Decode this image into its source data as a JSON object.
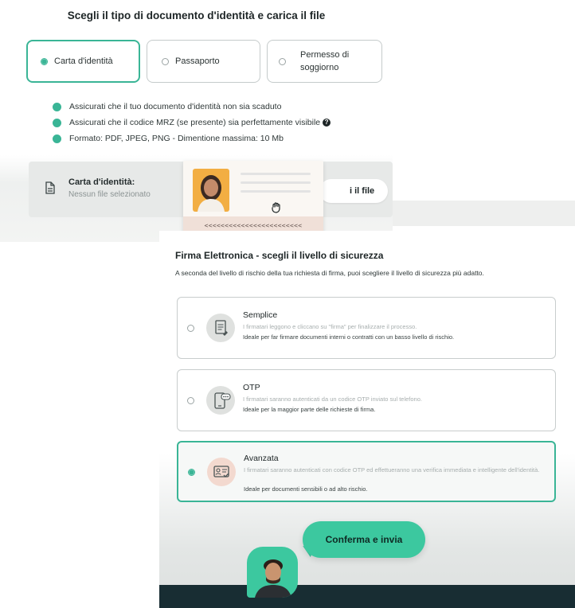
{
  "colors": {
    "accent": "#3ab596",
    "button": "#3cc89f",
    "footer": "#182d33"
  },
  "upload": {
    "title": "Scegli il tipo di documento d'identità e carica il file",
    "doc_types": [
      {
        "label": "Carta d'identità",
        "selected": true
      },
      {
        "label": "Passaporto",
        "selected": false
      },
      {
        "label_line1": "Permesso di",
        "label_line2": "soggiorno",
        "selected": false
      }
    ],
    "checks": [
      "Assicurati che il tuo documento d'identità non sia scaduto",
      "Assicurati che il codice MRZ (se presente) sia perfettamente visibile",
      "Formato: PDF, JPEG, PNG - Dimentione massima: 10 Mb"
    ],
    "info_icon": "?",
    "file": {
      "title": "Carta d'identità:",
      "status": "Nessun file selezionato",
      "button_fragment": "i il file"
    },
    "id_card": {
      "mrz": "<<<<<<<<<<<<<<<<<<<<<<<<"
    },
    "icons": [
      "file-icon",
      "hand-tap-icon",
      "info-icon"
    ]
  },
  "signature": {
    "title": "Firma Elettronica - scegli il livello di sicurezza",
    "subtitle": "A seconda del livello di rischio della tua richiesta di firma, puoi scegliere il livello di sicurezza più adatto.",
    "options": [
      {
        "name": "Semplice",
        "desc": "I firmatari leggono e cliccano su \"firma\" per finalizzare il processo.",
        "note": "Ideale per far firmare documenti interni o contratti con un basso livello di rischio.",
        "selected": false,
        "icon": "document-sign-icon"
      },
      {
        "name": "OTP",
        "desc": "I firmatari saranno autenticati da un codice OTP inviato sul telefono.",
        "note": "Ideale per la maggior parte delle richieste di firma.",
        "selected": false,
        "icon": "phone-otp-icon"
      },
      {
        "name": "Avanzata",
        "desc": "I firmatari saranno autenticati con codice OTP ed effettueranno una verifica immediata e intelligente dell'identità.",
        "note": "Ideale per documenti sensibili o ad alto rischio.",
        "selected": true,
        "icon": "id-verify-icon"
      }
    ],
    "confirm": "Conferma e invia"
  }
}
